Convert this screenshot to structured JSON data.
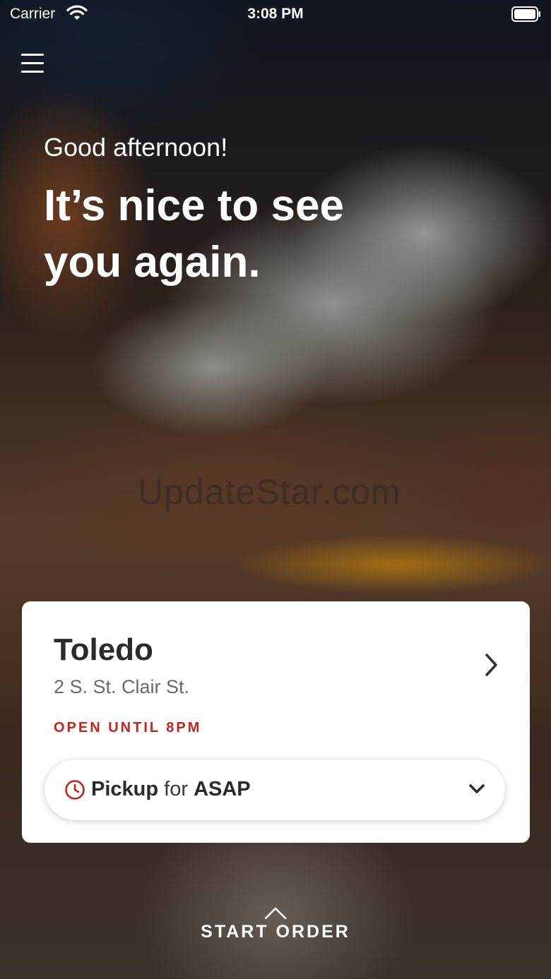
{
  "status_bar": {
    "carrier": "Carrier",
    "time": "3:08 PM"
  },
  "watermark": "UpdateStar.com",
  "greeting": {
    "salutation": "Good afternoon!",
    "headline": "It’s nice to see you again."
  },
  "store": {
    "name": "Toledo",
    "address": "2 S. St. Clair St.",
    "hours": "OPEN UNTIL 8PM",
    "hours_color": "#c8231b"
  },
  "order_mode": {
    "mode": "Pickup",
    "connector": "for",
    "time": "ASAP"
  },
  "cta": {
    "label": "START ORDER"
  },
  "icons": [
    "wifi-icon",
    "battery-icon",
    "menu-icon",
    "chevron-right-icon",
    "clock-icon",
    "chevron-down-icon",
    "chevron-up-icon"
  ]
}
